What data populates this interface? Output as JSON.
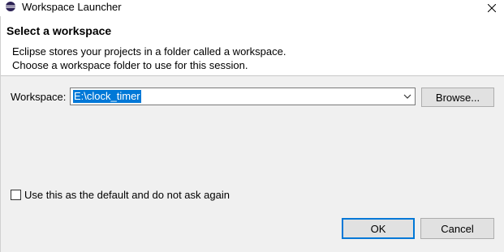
{
  "window": {
    "title": "Workspace Launcher",
    "icon": "eclipse-icon",
    "close_icon": "close-icon"
  },
  "header": {
    "title": "Select a workspace",
    "description_line1": "Eclipse stores your projects in a folder called a workspace.",
    "description_line2": "Choose a workspace folder to use for this session."
  },
  "workspace": {
    "label": "Workspace:",
    "value": "E:\\clock_timer",
    "browse_label": "Browse..."
  },
  "options": {
    "default_checkbox_label": "Use this as the default and do not ask again",
    "default_checked": false
  },
  "buttons": {
    "ok_label": "OK",
    "cancel_label": "Cancel"
  },
  "colors": {
    "selection": "#0078d7",
    "default_button_border": "#0078d7"
  }
}
